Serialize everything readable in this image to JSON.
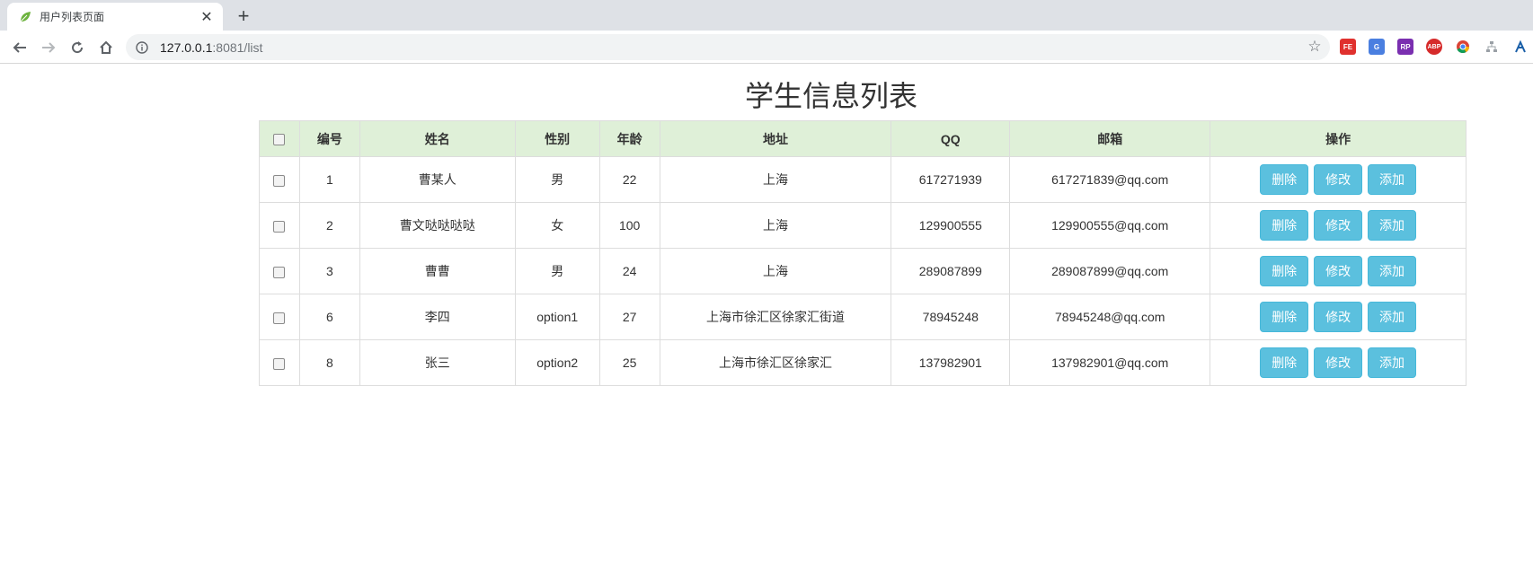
{
  "browser": {
    "tab_title": "用户列表页面",
    "tab_favicon": "leaf-icon",
    "new_tab_label": "+",
    "close_label": "✕",
    "url_host": "127.0.0.1",
    "url_rest": ":8081/list",
    "extensions": [
      "FE",
      "G",
      "RP",
      "ABP",
      "chrome-icon",
      "sitemap-icon",
      "network-icon"
    ]
  },
  "page": {
    "title": "学生信息列表"
  },
  "table": {
    "headers": [
      "编号",
      "姓名",
      "性别",
      "年龄",
      "地址",
      "QQ",
      "邮箱",
      "操作"
    ],
    "rows": [
      {
        "id": "1",
        "name": "曹某人",
        "gender": "男",
        "age": "22",
        "address": "上海",
        "qq": "617271939",
        "email": "617271839@qq.com"
      },
      {
        "id": "2",
        "name": "曹文哒哒哒哒",
        "gender": "女",
        "age": "100",
        "address": "上海",
        "qq": "129900555",
        "email": "129900555@qq.com"
      },
      {
        "id": "3",
        "name": "曹曹",
        "gender": "男",
        "age": "24",
        "address": "上海",
        "qq": "289087899",
        "email": "289087899@qq.com"
      },
      {
        "id": "6",
        "name": "李四",
        "gender": "option1",
        "age": "27",
        "address": "上海市徐汇区徐家汇街道",
        "qq": "78945248",
        "email": "78945248@qq.com"
      },
      {
        "id": "8",
        "name": "张三",
        "gender": "option2",
        "age": "25",
        "address": "上海市徐汇区徐家汇",
        "qq": "137982901",
        "email": "137982901@qq.com"
      }
    ],
    "actions": {
      "delete": "删除",
      "edit": "修改",
      "add": "添加"
    }
  },
  "colors": {
    "header_bg": "#dff0d8",
    "button_bg": "#5bc0de"
  }
}
